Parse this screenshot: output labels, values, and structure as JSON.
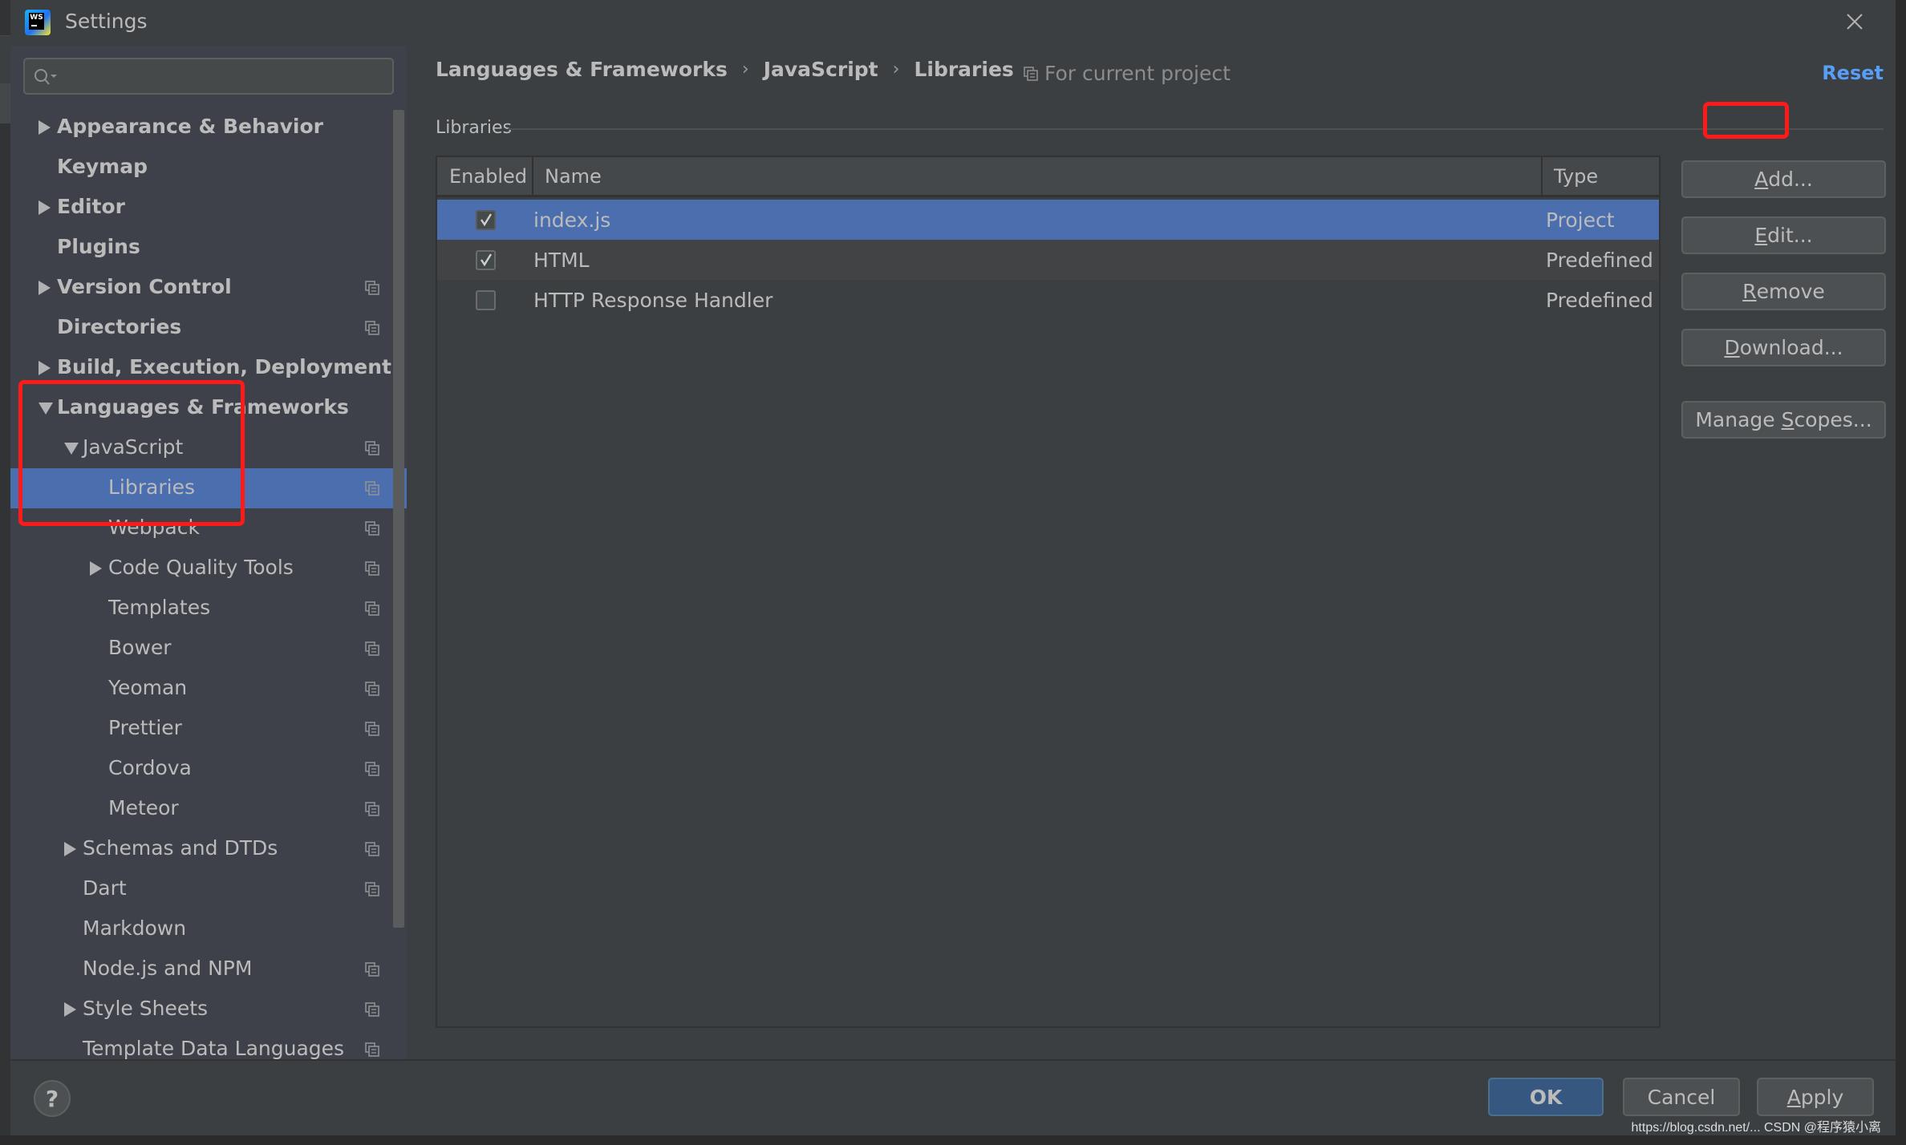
{
  "window": {
    "title": "Settings",
    "app_icon": "webstorm-logo",
    "close_icon": "close-icon"
  },
  "search": {
    "value": "",
    "placeholder": "",
    "icon": "search-icon"
  },
  "sidebar": {
    "items": [
      {
        "label": "Appearance & Behavior",
        "level": 0,
        "bold": true,
        "expander": "collapsed",
        "project_icon": false
      },
      {
        "label": "Keymap",
        "level": 0,
        "bold": true,
        "expander": "none",
        "project_icon": false
      },
      {
        "label": "Editor",
        "level": 0,
        "bold": true,
        "expander": "collapsed",
        "project_icon": false
      },
      {
        "label": "Plugins",
        "level": 0,
        "bold": true,
        "expander": "none",
        "project_icon": false
      },
      {
        "label": "Version Control",
        "level": 0,
        "bold": true,
        "expander": "collapsed",
        "project_icon": true
      },
      {
        "label": "Directories",
        "level": 0,
        "bold": true,
        "expander": "none",
        "project_icon": true
      },
      {
        "label": "Build, Execution, Deployment",
        "level": 0,
        "bold": true,
        "expander": "collapsed",
        "project_icon": false
      },
      {
        "label": "Languages & Frameworks",
        "level": 0,
        "bold": true,
        "expander": "expanded",
        "project_icon": false
      },
      {
        "label": "JavaScript",
        "level": 1,
        "bold": false,
        "expander": "expanded",
        "project_icon": true
      },
      {
        "label": "Libraries",
        "level": 2,
        "bold": false,
        "expander": "none",
        "project_icon": true,
        "selected": true
      },
      {
        "label": "Webpack",
        "level": 2,
        "bold": false,
        "expander": "none",
        "project_icon": true
      },
      {
        "label": "Code Quality Tools",
        "level": 2,
        "bold": false,
        "expander": "collapsed",
        "project_icon": true
      },
      {
        "label": "Templates",
        "level": 2,
        "bold": false,
        "expander": "none",
        "project_icon": true
      },
      {
        "label": "Bower",
        "level": 2,
        "bold": false,
        "expander": "none",
        "project_icon": true
      },
      {
        "label": "Yeoman",
        "level": 2,
        "bold": false,
        "expander": "none",
        "project_icon": true
      },
      {
        "label": "Prettier",
        "level": 2,
        "bold": false,
        "expander": "none",
        "project_icon": true
      },
      {
        "label": "Cordova",
        "level": 2,
        "bold": false,
        "expander": "none",
        "project_icon": true
      },
      {
        "label": "Meteor",
        "level": 2,
        "bold": false,
        "expander": "none",
        "project_icon": true
      },
      {
        "label": "Schemas and DTDs",
        "level": 1,
        "bold": false,
        "expander": "collapsed",
        "project_icon": true
      },
      {
        "label": "Dart",
        "level": 1,
        "bold": false,
        "expander": "none",
        "project_icon": true
      },
      {
        "label": "Markdown",
        "level": 1,
        "bold": false,
        "expander": "none",
        "project_icon": false
      },
      {
        "label": "Node.js and NPM",
        "level": 1,
        "bold": false,
        "expander": "none",
        "project_icon": true
      },
      {
        "label": "Style Sheets",
        "level": 1,
        "bold": false,
        "expander": "collapsed",
        "project_icon": true
      },
      {
        "label": "Template Data Languages",
        "level": 1,
        "bold": false,
        "expander": "none",
        "project_icon": true
      }
    ]
  },
  "main": {
    "breadcrumb": [
      "Languages & Frameworks",
      "JavaScript",
      "Libraries"
    ],
    "breadcrumb_separator": "›",
    "scope_note": "For current project",
    "reset_label": "Reset",
    "section_title": "Libraries",
    "table": {
      "columns": [
        "Enabled",
        "Name",
        "Type"
      ],
      "rows": [
        {
          "enabled": true,
          "name": "index.js",
          "type": "Project",
          "selected": true
        },
        {
          "enabled": true,
          "name": "HTML",
          "type": "Predefined",
          "selected": false
        },
        {
          "enabled": false,
          "name": "HTTP Response Handler",
          "type": "Predefined",
          "selected": false
        }
      ]
    },
    "buttons": [
      {
        "id": "add",
        "pre": "",
        "mnemonic": "A",
        "post": "dd..."
      },
      {
        "id": "edit",
        "pre": "",
        "mnemonic": "E",
        "post": "dit..."
      },
      {
        "id": "remove",
        "pre": "",
        "mnemonic": "R",
        "post": "emove"
      },
      {
        "id": "download",
        "pre": "",
        "mnemonic": "D",
        "post": "ownload..."
      },
      {
        "id": "manage-scopes",
        "pre": "Manage ",
        "mnemonic": "S",
        "post": "copes..."
      }
    ]
  },
  "footer": {
    "help_label": "?",
    "ok_label": "OK",
    "cancel_label": "Cancel",
    "apply_mnemonic": "A",
    "apply_rest": "pply"
  },
  "watermark": "https://blog.csdn.net/... CSDN @程序猿小离",
  "colors": {
    "selection": "#4b6eaf",
    "link": "#589df6",
    "annotation": "#ff1a1a",
    "ok_button": "#365880"
  }
}
